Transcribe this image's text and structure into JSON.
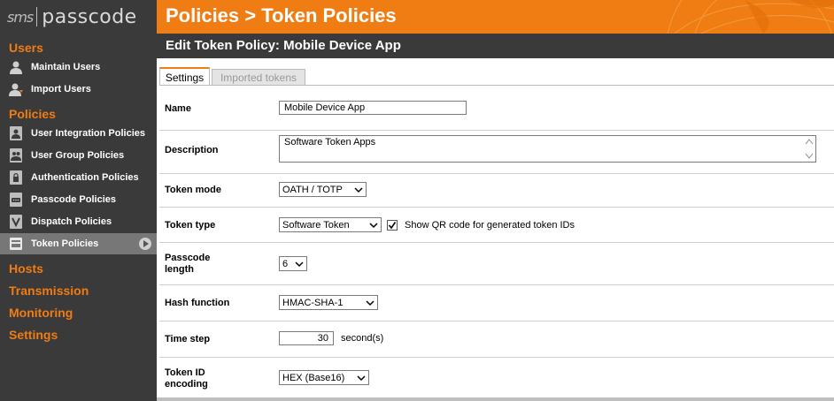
{
  "app": {
    "logo_left": "sms",
    "logo_right": "passcode",
    "title": "Policies > Token Policies"
  },
  "sidebar": {
    "sections": [
      {
        "label": "Users",
        "items": [
          {
            "label": "Maintain Users",
            "icon": "user-icon"
          },
          {
            "label": "Import Users",
            "icon": "user-import-icon"
          }
        ]
      },
      {
        "label": "Policies",
        "items": [
          {
            "label": "User Integration Policies",
            "icon": "user-integration-icon"
          },
          {
            "label": "User Group Policies",
            "icon": "user-group-icon"
          },
          {
            "label": "Authentication Policies",
            "icon": "lock-icon"
          },
          {
            "label": "Passcode Policies",
            "icon": "passcode-icon"
          },
          {
            "label": "Dispatch Policies",
            "icon": "dispatch-icon"
          },
          {
            "label": "Token Policies",
            "icon": "token-icon",
            "active": true
          }
        ]
      },
      {
        "label": "Hosts"
      },
      {
        "label": "Transmission"
      },
      {
        "label": "Monitoring"
      },
      {
        "label": "Settings"
      }
    ]
  },
  "page": {
    "heading": "Edit Token Policy: Mobile Device App",
    "tabs": [
      {
        "label": "Settings",
        "active": true
      },
      {
        "label": "Imported tokens",
        "active": false
      }
    ]
  },
  "form": {
    "name": {
      "label": "Name",
      "value": "Mobile Device App"
    },
    "description": {
      "label": "Description",
      "value": "Software Token Apps"
    },
    "token_mode": {
      "label": "Token mode",
      "value": "OATH / TOTP"
    },
    "token_type": {
      "label": "Token type",
      "value": "Software Token",
      "checkbox_label": "Show QR code for generated token IDs",
      "checkbox_checked": true
    },
    "passcode_length": {
      "label_line1": "Passcode",
      "label_line2": "length",
      "value": "6"
    },
    "hash_function": {
      "label": "Hash function",
      "value": "HMAC-SHA-1"
    },
    "time_step": {
      "label": "Time step",
      "value": "30",
      "unit": "second(s)"
    },
    "token_id_encoding": {
      "label_line1": "Token ID",
      "label_line2": "encoding",
      "value": "HEX (Base16)"
    }
  },
  "colors": {
    "accent": "#ef7d14",
    "sidebar_bg": "#3a3a3a",
    "active_item": "#777777"
  }
}
